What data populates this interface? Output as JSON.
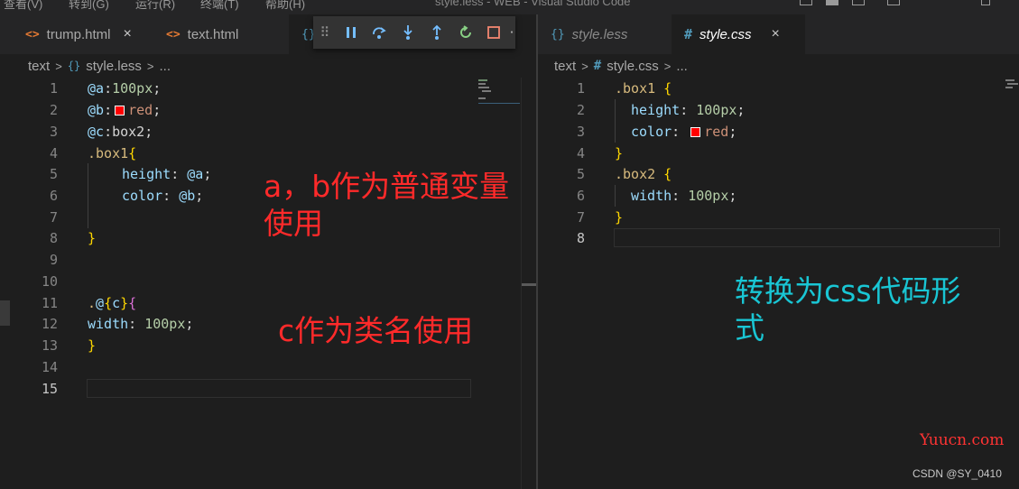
{
  "menu": [
    "查看(V)",
    "转到(G)",
    "运行(R)",
    "终端(T)",
    "帮助(H)"
  ],
  "window_title": "style.less - WEB - Visual Studio Code",
  "left_tabs": [
    {
      "label": "trump.html",
      "icon": "html-file-icon"
    },
    {
      "label": "text.html",
      "icon": "html-file-icon"
    },
    {
      "label": "",
      "icon": "less-file-icon"
    }
  ],
  "right_tabs": [
    {
      "label": "style.less",
      "icon": "less-file-icon"
    },
    {
      "label": "style.css",
      "icon": "css-file-icon"
    }
  ],
  "close_glyph": "×",
  "debug_toolbar": [
    "grip-icon",
    "pause-icon",
    "step-over-icon",
    "step-into-icon",
    "step-out-icon",
    "restart-icon",
    "stop-icon"
  ],
  "left_breadcrumb": {
    "folder": "text",
    "file": "style.less",
    "more": "..."
  },
  "right_breadcrumb": {
    "folder": "text",
    "file": "style.css",
    "more": "..."
  },
  "left_line_numbers": [
    "1",
    "2",
    "3",
    "4",
    "5",
    "6",
    "7",
    "8",
    "9",
    "10",
    "11",
    "12",
    "13",
    "14",
    "15"
  ],
  "right_line_numbers": [
    "1",
    "2",
    "3",
    "4",
    "5",
    "6",
    "7",
    "8"
  ],
  "left_code": {
    "l1": {
      "v": "@a",
      "c": ":",
      "n": "100px",
      "s": ";"
    },
    "l2": {
      "v": "@b",
      "c": ":",
      "str": "red",
      "s": ";"
    },
    "l3": {
      "v": "@c",
      "c": ":",
      "t": "box2",
      "s": ";"
    },
    "l4": {
      "sel": ".box1",
      "b": "{"
    },
    "l5": {
      "p": "height",
      "c": ": ",
      "v": "@a",
      "s": ";"
    },
    "l6": {
      "p": "color",
      "c": ": ",
      "v": "@b",
      "s": ";"
    },
    "l8": {
      "b": "}"
    },
    "l11": {
      "dot": ".",
      "at": "@",
      "b1": "{",
      "v": "c",
      "b2": "}",
      "b3": "{"
    },
    "l12": {
      "p": "width",
      "c": ": ",
      "n": "100px",
      "s": ";"
    },
    "l13": {
      "b": "}"
    }
  },
  "right_code": {
    "l1": {
      "sel": ".box1",
      "b": " {"
    },
    "l2": {
      "p": "height",
      "c": ": ",
      "n": "100px",
      "s": ";"
    },
    "l3": {
      "p": "color",
      "c": ": ",
      "str": "red",
      "s": ";"
    },
    "l4": {
      "b": "}"
    },
    "l5": {
      "sel": ".box2",
      "b": " {"
    },
    "l6": {
      "p": "width",
      "c": ": ",
      "n": "100px",
      "s": ";"
    },
    "l7": {
      "b": "}"
    }
  },
  "annotations": {
    "ab_vars": "a，b作为普通变量\n使用",
    "c_class": "c作为类名使用",
    "to_css": "转换为css代码形\n式"
  },
  "watermarks": {
    "yuucn": "Yuucn.com",
    "csdn": "CSDN @SY_0410"
  },
  "colors": {
    "swatch": "#ff0000",
    "annot_red": "#ff2a2a",
    "annot_cyan": "#19c6d4"
  }
}
